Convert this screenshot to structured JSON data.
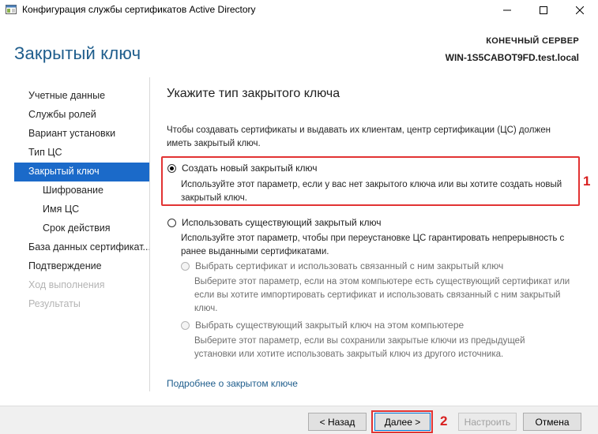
{
  "window": {
    "title": "Конфигурация службы сертификатов Active Directory"
  },
  "header": {
    "page_title": "Закрытый ключ",
    "destination_label": "КОНЕЧНЫЙ СЕРВЕР",
    "destination_server": "WIN-1S5CABOT9FD.test.local"
  },
  "sidebar": {
    "items": [
      {
        "label": "Учетные данные",
        "state": "normal"
      },
      {
        "label": "Службы ролей",
        "state": "normal"
      },
      {
        "label": "Вариант установки",
        "state": "normal"
      },
      {
        "label": "Тип ЦС",
        "state": "normal"
      },
      {
        "label": "Закрытый ключ",
        "state": "active"
      },
      {
        "label": "Шифрование",
        "state": "sub"
      },
      {
        "label": "Имя ЦС",
        "state": "sub"
      },
      {
        "label": "Срок действия",
        "state": "sub"
      },
      {
        "label": "База данных сертификат...",
        "state": "normal"
      },
      {
        "label": "Подтверждение",
        "state": "normal"
      },
      {
        "label": "Ход выполнения",
        "state": "disabled"
      },
      {
        "label": "Результаты",
        "state": "disabled"
      }
    ]
  },
  "main": {
    "section_title": "Укажите тип закрытого ключа",
    "intro": "Чтобы создавать сертификаты и выдавать их клиентам, центр сертификации (ЦС) должен иметь закрытый ключ.",
    "option_new": {
      "label": "Создать новый закрытый ключ",
      "description": "Используйте этот параметр, если у вас нет закрытого ключа или вы хотите создать новый закрытый ключ.",
      "selected": true
    },
    "option_existing": {
      "label": "Использовать существующий закрытый ключ",
      "description": "Используйте этот параметр, чтобы при переустановке ЦС гарантировать непрерывность с ранее выданными сертификатами.",
      "selected": false
    },
    "sub_option_cert": {
      "label": "Выбрать сертификат и использовать связанный с ним закрытый ключ",
      "description": "Выберите этот параметр, если на этом компьютере есть существующий сертификат или если вы хотите импортировать сертификат и использовать связанный с ним закрытый ключ.",
      "enabled": false
    },
    "sub_option_key": {
      "label": "Выбрать существующий закрытый ключ на этом компьютере",
      "description": "Выберите этот параметр, если вы сохранили закрытые ключи из предыдущей установки или хотите использовать закрытый ключ из другого источника.",
      "enabled": false
    },
    "more_link": "Подробнее о закрытом ключе"
  },
  "annotations": {
    "callout_1": "1",
    "callout_2": "2"
  },
  "footer": {
    "back_label": "< Назад",
    "next_label": "Далее >",
    "configure_label": "Настроить",
    "cancel_label": "Отмена"
  },
  "colors": {
    "accent": "#1b6ac9",
    "title_blue": "#1e5d8c",
    "annotation_red": "#e23333"
  }
}
